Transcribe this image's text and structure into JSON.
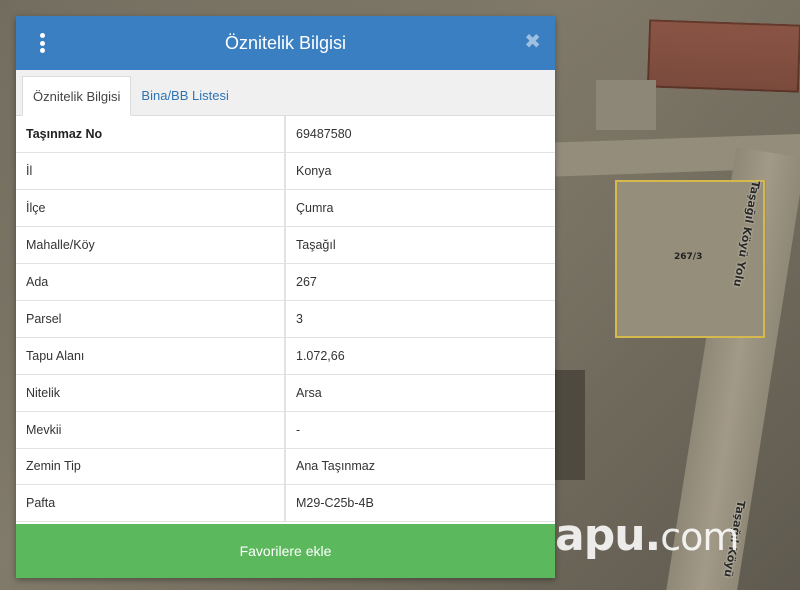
{
  "popup": {
    "title": "Öznitelik Bilgisi",
    "tabs": [
      {
        "label": "Öznitelik Bilgisi",
        "active": true
      },
      {
        "label": "Bina/BB Listesi",
        "active": false
      }
    ],
    "rows": [
      {
        "key": "Taşınmaz No",
        "value": "69487580"
      },
      {
        "key": "İl",
        "value": "Konya"
      },
      {
        "key": "İlçe",
        "value": "Çumra"
      },
      {
        "key": "Mahalle/Köy",
        "value": "Taşağıl"
      },
      {
        "key": "Ada",
        "value": "267"
      },
      {
        "key": "Parsel",
        "value": "3"
      },
      {
        "key": "Tapu Alanı",
        "value": "1.072,66"
      },
      {
        "key": "Nitelik",
        "value": "Arsa"
      },
      {
        "key": "Mevkii",
        "value": "-"
      },
      {
        "key": "Zemin Tip",
        "value": "Ana Taşınmaz"
      },
      {
        "key": "Pafta",
        "value": "M29-C25b-4B"
      }
    ],
    "favorite_button_label": "Favorilere ekle",
    "icons": {
      "menu": "vertical-dots-icon",
      "close": "close-icon"
    }
  },
  "map": {
    "parcel_label": "267/3",
    "road_label": "Taşağıl Köyü Yolu",
    "road_label_2": "Taşağıl Köyü",
    "watermark_main": "tapu.",
    "watermark_suffix": "com"
  },
  "colors": {
    "header": "#3a7fc1",
    "favorite_button": "#5cb85c",
    "tab_link": "#2e74b5",
    "parcel_outline": "#d6b94c"
  }
}
